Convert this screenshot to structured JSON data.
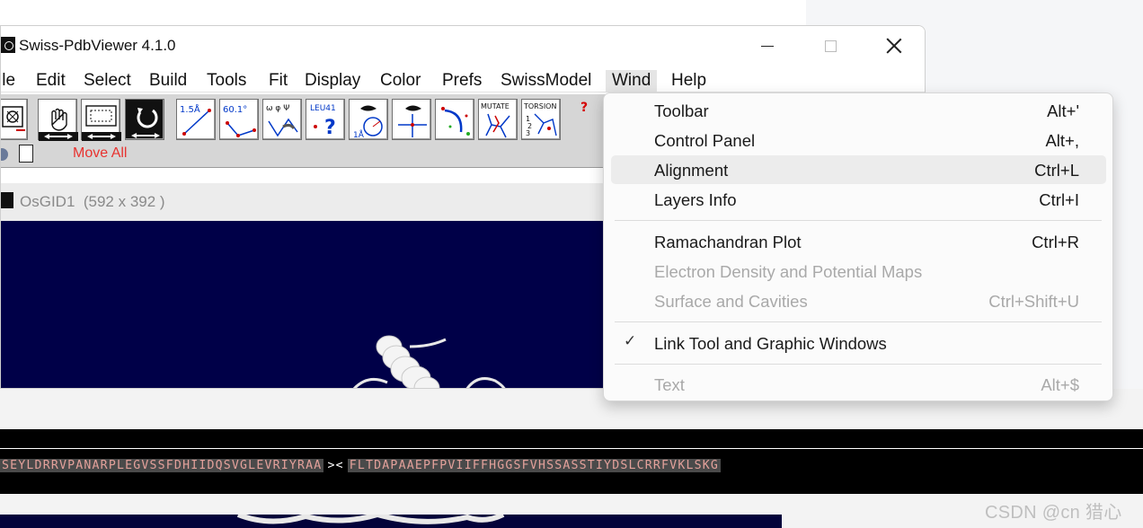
{
  "window": {
    "title": "Swiss-PdbViewer 4.1.0"
  },
  "menubar": {
    "items": [
      "ile",
      "Edit",
      "Select",
      "Build",
      "Tools",
      "Fit",
      "Display",
      "Color",
      "Prefs",
      "SwissModel",
      "Wind",
      "Help"
    ],
    "active": "Wind"
  },
  "toolbar": {
    "move_all_label": "Move All",
    "help_glyph": "?",
    "tool_labels": {
      "distance": "1.5Å",
      "angle": "60.1°",
      "torsion": "ω φ Ψ",
      "identify": "LEU41",
      "mutate": "MUTATE",
      "torsion_tool": "TORSION"
    },
    "icons": [
      "center-icon",
      "hand-icon",
      "zoom-icon",
      "rotate-icon",
      "distance-icon",
      "angle-icon",
      "torsion-angle-icon",
      "identify-icon",
      "neighbors-icon",
      "center-atom-icon",
      "hbond-icon",
      "mutate-icon",
      "fix-torsion-icon"
    ]
  },
  "graphic_window": {
    "title": "OsGID1",
    "size": "(592 x 392 )"
  },
  "wind_menu": {
    "groups": [
      [
        {
          "label": "Toolbar",
          "shortcut": "Alt+'",
          "enabled": true,
          "checked": false,
          "hover": false
        },
        {
          "label": "Control Panel",
          "shortcut": "Alt+,",
          "enabled": true,
          "checked": false,
          "hover": false
        },
        {
          "label": "Alignment",
          "shortcut": "Ctrl+L",
          "enabled": true,
          "checked": false,
          "hover": true
        },
        {
          "label": "Layers Info",
          "shortcut": "Ctrl+I",
          "enabled": true,
          "checked": false,
          "hover": false
        }
      ],
      [
        {
          "label": "Ramachandran Plot",
          "shortcut": "Ctrl+R",
          "enabled": true,
          "checked": false,
          "hover": false
        },
        {
          "label": "Electron Density and Potential Maps",
          "shortcut": "",
          "enabled": false,
          "checked": false,
          "hover": false
        },
        {
          "label": "Surface and Cavities",
          "shortcut": "Ctrl+Shift+U",
          "enabled": false,
          "checked": false,
          "hover": false
        }
      ],
      [
        {
          "label": "Link Tool and Graphic Windows",
          "shortcut": "",
          "enabled": true,
          "checked": true,
          "hover": false
        }
      ],
      [
        {
          "label": "Text",
          "shortcut": "Alt+$",
          "enabled": false,
          "checked": false,
          "hover": false
        }
      ]
    ]
  },
  "alignment": {
    "seq_left": "SEYLDRRVPANARPLEGVSSFDHIIDQSVGLEVRIYRAA",
    "seq_mid": "><",
    "seq_right": "FLTDAPAAEPFPVIIFFHGGSFVHSSASSTIYDSLCRRFVKLSKG"
  },
  "watermark": "CSDN @cn 猎心",
  "colors": {
    "viewport": "#000048",
    "seq_text": "#e3a19b",
    "move_all": "#e8322f"
  }
}
